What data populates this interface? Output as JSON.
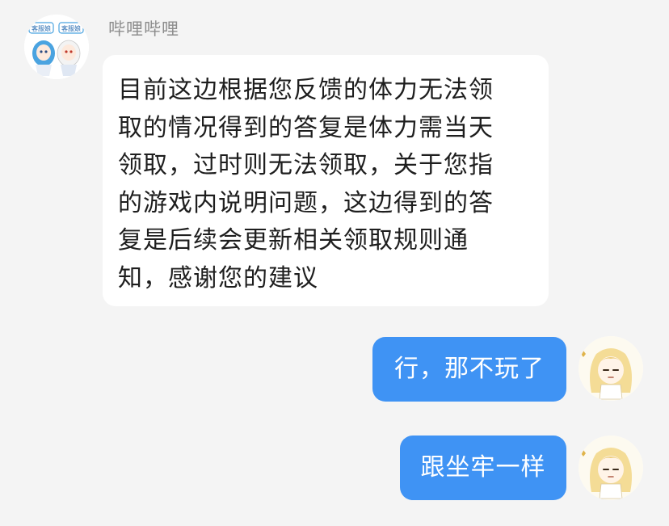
{
  "conversation": {
    "service": {
      "sender_name": "哔哩哔哩",
      "avatar_badge_left": "客服娘",
      "avatar_badge_right": "客服娘",
      "message_lines": [
        "目前这边根据您反馈的体力无法领",
        "取的情况得到的答复是体力需当天",
        "领取，过时则无法领取，关于您指",
        "的游戏内说明问题，这边得到的答",
        "复是后续会更新相关领取规则通",
        "知，感谢您的建议"
      ]
    },
    "user_messages": [
      {
        "text": "行，那不玩了"
      },
      {
        "text": "跟坐牢一样"
      }
    ]
  },
  "colors": {
    "background": "#f4f4f4",
    "incoming_bubble": "#ffffff",
    "outgoing_bubble": "#3f93f4",
    "sender_name": "#8d8d8d"
  },
  "icons": {
    "service_avatar": "customer-service-mascot-avatar",
    "user_avatar": "anime-girl-avatar"
  }
}
